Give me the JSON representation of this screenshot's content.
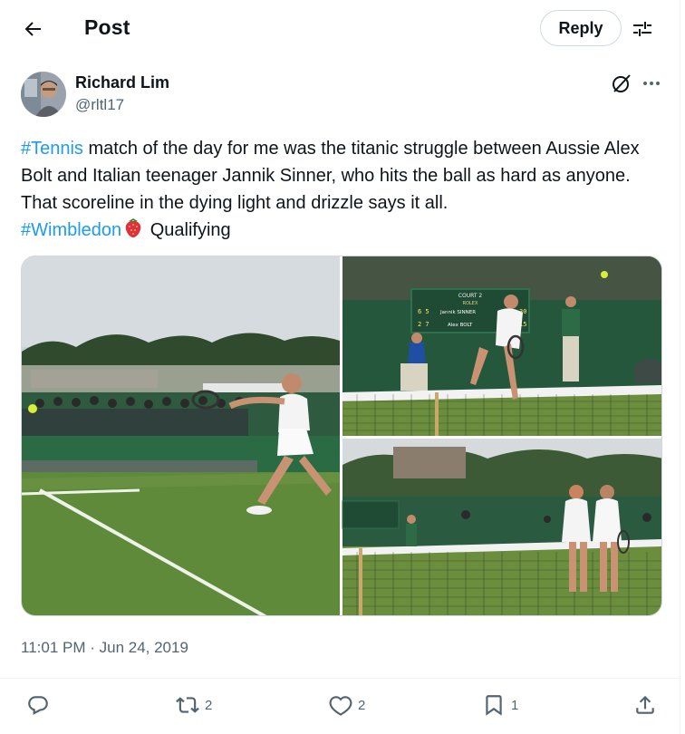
{
  "header": {
    "title": "Post",
    "reply_label": "Reply"
  },
  "author": {
    "name": "Richard Lim",
    "handle": "@rltl17"
  },
  "tweet": {
    "hashtag1": "#Tennis",
    "line1_rest": " match of the day for me was the titanic struggle between Aussie Alex Bolt and Italian teenager Jannik Sinner, who hits the ball as hard as anyone. That scoreline in the dying light and drizzle says it all.",
    "hashtag2": "#Wimbledon",
    "after_emoji": " Qualifying"
  },
  "timestamp": "11:01 PM · Jun 24, 2019",
  "scoreboard": {
    "court": "COURT 2",
    "brand": "ROLEX",
    "player1": "Jannik SINNER",
    "player2": "Alex BOLT",
    "p1_sets": "6 5",
    "p2_sets": "2 7",
    "p1_last": "30",
    "p2_last": "15"
  },
  "stats": {
    "retweets": "2",
    "likes": "2",
    "bookmarks": "1"
  },
  "icons": [
    "back-arrow-icon",
    "settings-sliders-icon",
    "grok-icon",
    "more-icon",
    "reply-icon",
    "retweet-icon",
    "heart-icon",
    "bookmark-icon",
    "share-icon",
    "strawberry-icon"
  ],
  "colors": {
    "link": "#1d9bf0",
    "muted": "#536471",
    "text": "#0f1419",
    "border": "#cfd9de"
  }
}
